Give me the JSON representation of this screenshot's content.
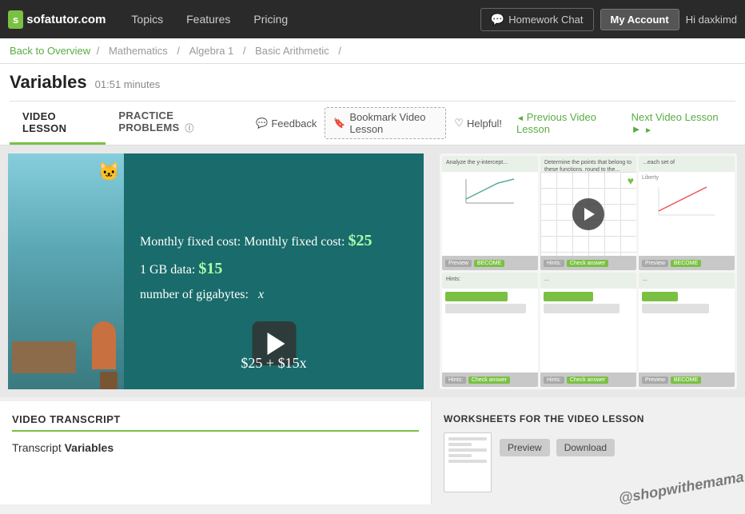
{
  "navbar": {
    "logo": "sofatutor.com",
    "nav_links": [
      {
        "label": "Topics"
      },
      {
        "label": "Features"
      },
      {
        "label": "Pricing"
      }
    ],
    "homework_chat": "Homework Chat",
    "my_account": "My Account",
    "greeting": "Hi daxkimd"
  },
  "breadcrumb": {
    "back": "Back to Overview",
    "sep1": "/",
    "crumb1": "Mathematics",
    "sep2": "/",
    "crumb2": "Algebra 1",
    "sep3": "/",
    "crumb3": "Basic Arithmetic",
    "sep4": "/"
  },
  "lesson": {
    "title": "Variables",
    "duration": "01:51 minutes"
  },
  "tabs": {
    "video_lesson": "VIDEO LESSON",
    "practice_problems": "PRACTICE PROBLEMS"
  },
  "actions": {
    "feedback": "Feedback",
    "bookmark": "Bookmark Video Lesson",
    "helpful": "Helpful!",
    "prev_lesson": "Previous Video Lesson",
    "next_lesson": "Next Video Lesson"
  },
  "video": {
    "line1": "Monthly fixed cost: $25",
    "line2": "1 GB data: $15",
    "line3": "number of gigabytes:   x",
    "line4": "$25 + $15x"
  },
  "transcript": {
    "section_title": "VIDEO TRANSCRIPT",
    "text_prefix": "Transcript",
    "text_bold": "Variables"
  },
  "worksheets": {
    "section_title": "WORKSHEETS FOR THE VIDEO LESSON",
    "btn_preview": "Preview",
    "btn_download": "Download"
  },
  "watermark": "@shopwithemama"
}
